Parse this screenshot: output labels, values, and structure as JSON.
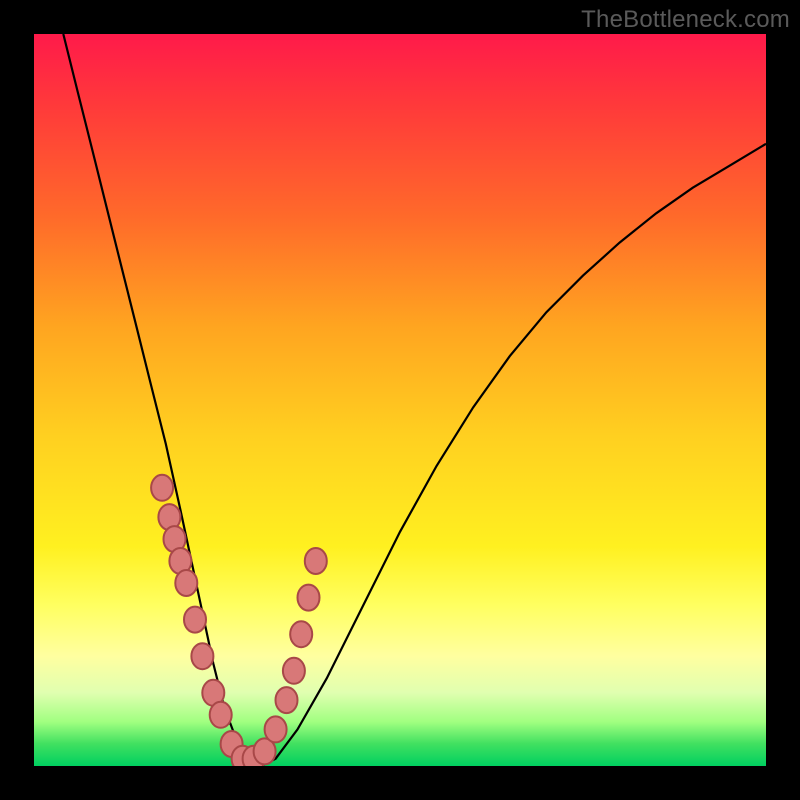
{
  "watermark": "TheBottleneck.com",
  "chart_data": {
    "type": "line",
    "title": "",
    "xlabel": "",
    "ylabel": "",
    "xlim": [
      0,
      100
    ],
    "ylim": [
      0,
      100
    ],
    "curve": {
      "name": "bottleneck-curve",
      "x": [
        4,
        6,
        8,
        10,
        12,
        14,
        16,
        18,
        20,
        21.5,
        23,
        24.5,
        26,
        27.5,
        29,
        31,
        33,
        36,
        40,
        45,
        50,
        55,
        60,
        65,
        70,
        75,
        80,
        85,
        90,
        95,
        100
      ],
      "y": [
        100,
        92,
        84,
        76,
        68,
        60,
        52,
        44,
        35,
        28,
        21,
        14,
        8,
        4,
        1,
        0,
        1,
        5,
        12,
        22,
        32,
        41,
        49,
        56,
        62,
        67,
        71.5,
        75.5,
        79,
        82,
        85
      ]
    },
    "series": [
      {
        "name": "left-branch-markers",
        "type": "scatter",
        "x": [
          17.5,
          18.5,
          19.2,
          20.0,
          20.8,
          22.0,
          23.0,
          24.5,
          25.5,
          27.0,
          28.5
        ],
        "y": [
          38,
          34,
          31,
          28,
          25,
          20,
          15,
          10,
          7,
          3,
          1
        ]
      },
      {
        "name": "right-branch-markers",
        "type": "scatter",
        "x": [
          30.0,
          31.5,
          33.0,
          34.5,
          35.5,
          36.5,
          37.5,
          38.5
        ],
        "y": [
          1,
          2,
          5,
          9,
          13,
          18,
          23,
          28
        ]
      }
    ],
    "background_gradient": {
      "top": "#ff1a4a",
      "mid": "#fff020",
      "bottom": "#00d060"
    }
  }
}
